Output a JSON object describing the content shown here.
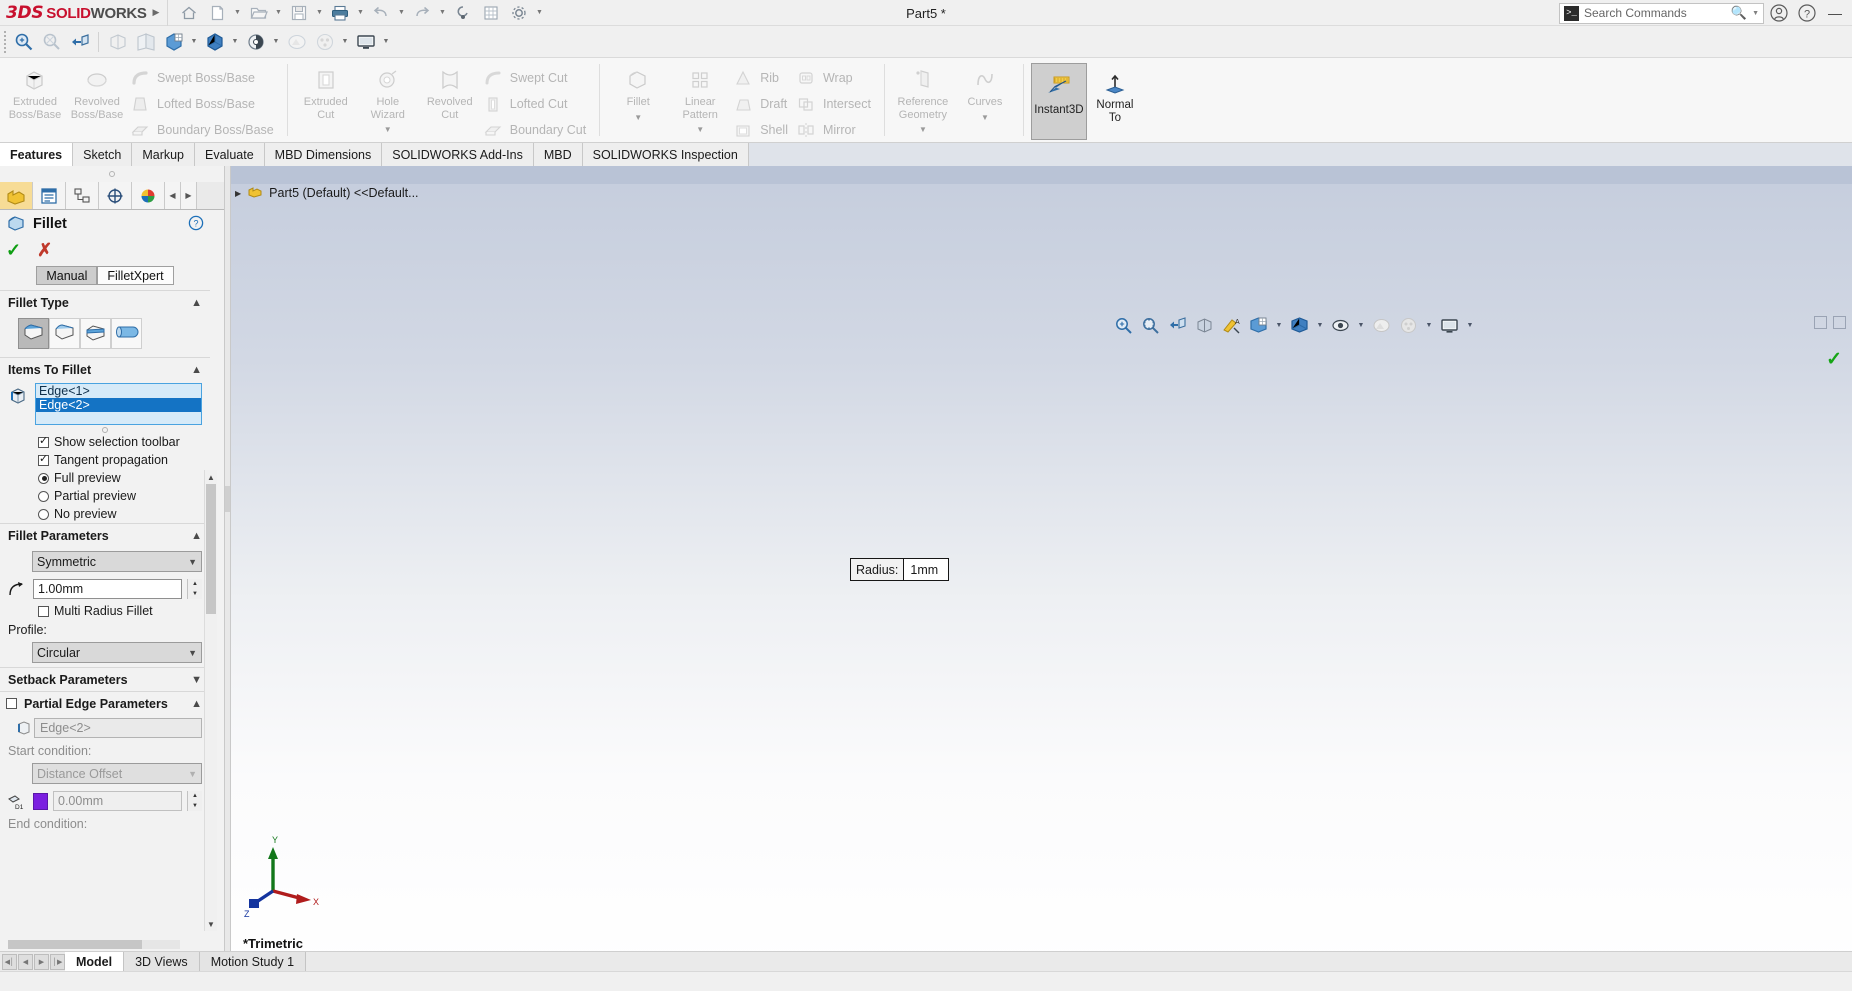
{
  "titlebar": {
    "brand_ds": "3DS",
    "brand_solid": "SOLID",
    "brand_works": "WORKS",
    "document_title": "Part5 *",
    "search_placeholder": "Search Commands",
    "icons": [
      "home-icon",
      "new-document-icon",
      "open-folder-icon",
      "save-icon",
      "print-icon",
      "undo-icon",
      "redo-icon",
      "rebuild-icon",
      "display-icon",
      "options-icon"
    ]
  },
  "view_toolbar": {
    "items": [
      "zoom-to-area-icon",
      "zoom-to-fit-icon",
      "previous-view-icon",
      "section-view-icon",
      "view-orientation-icon",
      "display-style-icon",
      "hide-show-items-icon",
      "edit-appearance-icon",
      "apply-scene-icon",
      "view-settings-icon"
    ]
  },
  "ribbon": {
    "groups": [
      {
        "name": "boss-base",
        "big": [
          {
            "label1": "Extruded",
            "label2": "Boss/Base",
            "icon": "extruded-boss-icon"
          },
          {
            "label1": "Revolved",
            "label2": "Boss/Base",
            "icon": "revolved-boss-icon"
          }
        ],
        "small": [
          {
            "label": "Swept Boss/Base",
            "icon": "swept-boss-icon"
          },
          {
            "label": "Lofted Boss/Base",
            "icon": "lofted-boss-icon"
          },
          {
            "label": "Boundary Boss/Base",
            "icon": "boundary-boss-icon"
          }
        ]
      },
      {
        "name": "cut",
        "big": [
          {
            "label1": "Extruded",
            "label2": "Cut",
            "icon": "extruded-cut-icon"
          },
          {
            "label1": "Hole",
            "label2": "Wizard",
            "icon": "hole-wizard-icon",
            "caret": true
          },
          {
            "label1": "Revolved",
            "label2": "Cut",
            "icon": "revolved-cut-icon"
          }
        ],
        "small": [
          {
            "label": "Swept Cut",
            "icon": "swept-cut-icon"
          },
          {
            "label": "Lofted Cut",
            "icon": "lofted-cut-icon"
          },
          {
            "label": "Boundary Cut",
            "icon": "boundary-cut-icon"
          }
        ]
      },
      {
        "name": "features",
        "big": [
          {
            "label1": "Fillet",
            "label2": "",
            "icon": "fillet-icon",
            "caret": true
          },
          {
            "label1": "Linear",
            "label2": "Pattern",
            "icon": "linear-pattern-icon",
            "caret": true
          }
        ],
        "small": [
          {
            "label": "Rib",
            "icon": "rib-icon"
          },
          {
            "label": "Draft",
            "icon": "draft-icon"
          },
          {
            "label": "Shell",
            "icon": "shell-icon"
          }
        ],
        "small2": [
          {
            "label": "Wrap",
            "icon": "wrap-icon"
          },
          {
            "label": "Intersect",
            "icon": "intersect-icon"
          },
          {
            "label": "Mirror",
            "icon": "mirror-icon"
          }
        ]
      },
      {
        "name": "reference",
        "big": [
          {
            "label1": "Reference",
            "label2": "Geometry",
            "icon": "reference-geometry-icon",
            "caret": true
          },
          {
            "label1": "Curves",
            "label2": "",
            "icon": "curves-icon",
            "caret": true
          }
        ]
      }
    ],
    "instant3d": {
      "label": "Instant3D",
      "icon": "instant3d-icon",
      "selected": true
    },
    "normal_to": {
      "label1": "Normal",
      "label2": "To",
      "icon": "normal-to-icon"
    }
  },
  "command_tabs": [
    {
      "label": "Features",
      "selected": true
    },
    {
      "label": "Sketch",
      "selected": false
    },
    {
      "label": "Markup",
      "selected": false
    },
    {
      "label": "Evaluate",
      "selected": false
    },
    {
      "label": "MBD Dimensions",
      "selected": false
    },
    {
      "label": "SOLIDWORKS Add-Ins",
      "selected": false
    },
    {
      "label": "MBD",
      "selected": false
    },
    {
      "label": "SOLIDWORKS Inspection",
      "selected": false
    }
  ],
  "property_manager": {
    "tabs": [
      "feature-manager-tab",
      "property-manager-tab",
      "configuration-manager-tab",
      "dimxpert-manager-tab",
      "display-manager-tab"
    ],
    "title": "Fillet",
    "help_icon": "help-icon",
    "ok_icon": "accept-check-icon",
    "cancel_icon": "cancel-x-icon",
    "mode_manual": "Manual",
    "mode_filletxpert": "FilletXpert",
    "section_fillet_type": "Fillet Type",
    "fillet_types": [
      "constant-size-fillet-icon",
      "variable-size-fillet-icon",
      "face-fillet-icon",
      "full-round-fillet-icon"
    ],
    "section_items_to_fillet": "Items To Fillet",
    "selected_edges": [
      "Edge<1>",
      "Edge<2>"
    ],
    "chk_show_selection_toolbar": "Show selection toolbar",
    "chk_tangent_propagation": "Tangent propagation",
    "radio_full_preview": "Full preview",
    "radio_partial_preview": "Partial preview",
    "radio_no_preview": "No preview",
    "section_fillet_parameters": "Fillet Parameters",
    "symmetry_value": "Symmetric",
    "radius_value": "1.00mm",
    "chk_multi_radius": "Multi Radius Fillet",
    "label_profile": "Profile:",
    "profile_value": "Circular",
    "section_setback_parameters": "Setback Parameters",
    "section_partial_edge_parameters": "Partial Edge Parameters",
    "partial_edge_value": "Edge<2>",
    "label_start_condition": "Start condition:",
    "start_condition_value": "Distance Offset",
    "offset_value": "0.00mm",
    "label_end_condition": "End condition:"
  },
  "graphics": {
    "feature_tree_root": "Part5 (Default) <<Default...",
    "view_label": "*Trimetric",
    "callout_label": "Radius:",
    "callout_value": "1mm",
    "triad_x": "X",
    "triad_y": "Y",
    "triad_z": "Z",
    "heads_up_icons": [
      "zoom-to-fit-icon",
      "zoom-to-area-icon",
      "previous-view-icon",
      "section-view-icon",
      "view-orientation-icon",
      "display-style-icon",
      "hide-show-icon",
      "edit-appearance-icon",
      "apply-scene-icon",
      "view-settings-icon"
    ],
    "confirm_icon": "confirm-check-icon"
  },
  "bottom_tabs": [
    {
      "label": "Model",
      "selected": true
    },
    {
      "label": "3D Views",
      "selected": false
    },
    {
      "label": "Motion Study 1",
      "selected": false
    }
  ],
  "colors": {
    "accent_red": "#c8102e",
    "selection_blue": "#1473c4",
    "selection_bg": "#d6eaf8",
    "preview_yellow": "#ffeb00",
    "highlight_orange": "#e08a3c",
    "edge_blue": "#4a9fe0",
    "ok_green": "#0e9e12",
    "cancel_red": "#c0392b",
    "purple_swatch": "#7b1fe0"
  }
}
